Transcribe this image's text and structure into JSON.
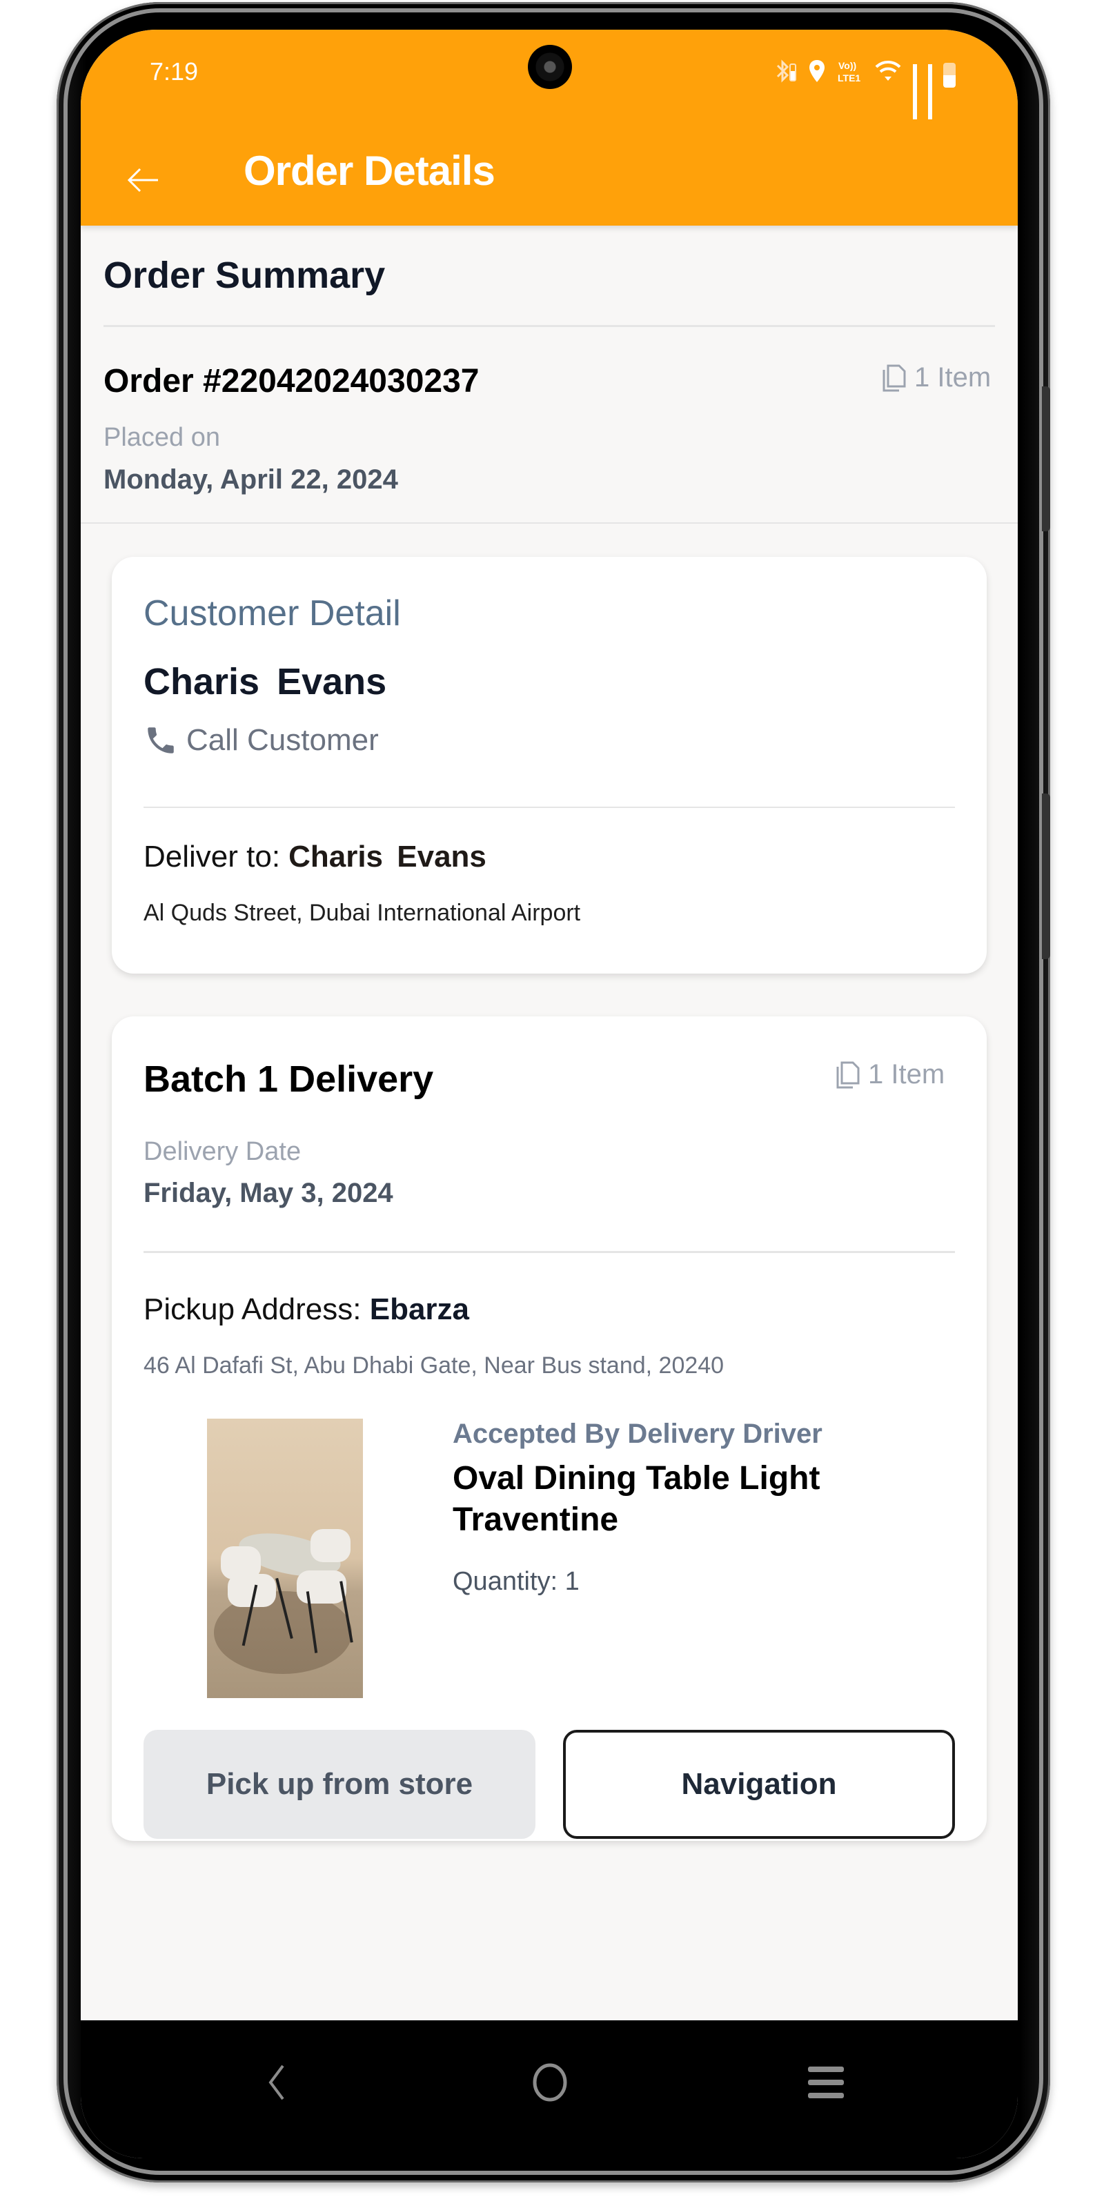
{
  "status_bar": {
    "time": "7:19",
    "icons": [
      "bluetooth-icon",
      "location-icon",
      "volte-icon",
      "wifi-icon",
      "signal-icon",
      "signal-icon",
      "battery-icon"
    ],
    "volte_label": "Vo)) LTE1"
  },
  "app_bar": {
    "title": "Order Details",
    "back_icon": "arrow-left-icon",
    "background": "#ffa10a"
  },
  "order_summary": {
    "heading": "Order Summary",
    "order_number": "Order #22042024030237",
    "items_count": "1 Item",
    "placed_label": "Placed on",
    "placed_date": "Monday, April 22, 2024"
  },
  "customer": {
    "heading": "Customer Detail",
    "name": "Charis  Evans",
    "call_label": "Call Customer",
    "deliver_label": "Deliver to:",
    "deliver_name": "Charis  Evans",
    "address": "Al Quds Street, Dubai International Airport"
  },
  "batch": {
    "title": "Batch 1 Delivery",
    "items_count": "1 Item",
    "delivery_date_label": "Delivery Date",
    "delivery_date": "Friday, May 3, 2024",
    "pickup_label": "Pickup Address:",
    "pickup_store": "Ebarza",
    "pickup_address": "46 Al Dafafi St, Abu Dhabi Gate, Near Bus stand, 20240",
    "product": {
      "status": "Accepted By Delivery Driver",
      "name": "Oval Dining Table Light Traventine",
      "quantity": "Quantity: 1",
      "image_alt": "Oval dining table with white chairs"
    },
    "buttons": {
      "pickup": "Pick up from store",
      "navigation": "Navigation"
    }
  },
  "system_nav": {
    "back": "back-icon",
    "home": "home-icon",
    "recents": "recents-icon"
  }
}
